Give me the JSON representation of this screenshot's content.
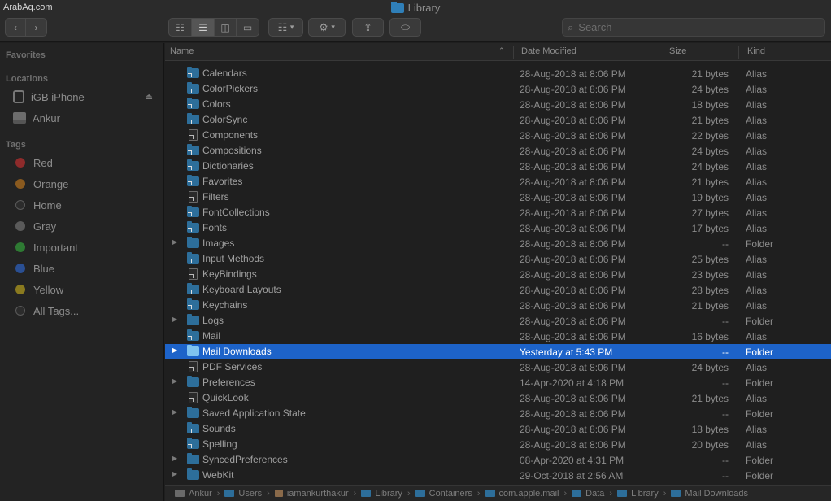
{
  "watermark": "ArabAq.com",
  "window": {
    "title": "Library"
  },
  "toolbar": {
    "back_icon": "chevron-left-icon",
    "forward_icon": "chevron-right-icon",
    "search_placeholder": "Search"
  },
  "sidebar": {
    "favorites_heading": "Favorites",
    "locations_heading": "Locations",
    "locations": [
      {
        "label": "iGB iPhone",
        "icon": "iphone-icon"
      },
      {
        "label": "Ankur",
        "icon": "hard-drive-icon"
      }
    ],
    "tags_heading": "Tags",
    "tags": [
      {
        "label": "Red",
        "color": "#8e2b2b"
      },
      {
        "label": "Orange",
        "color": "#8a5a1f"
      },
      {
        "label": "Home",
        "color": "#3a3a3a"
      },
      {
        "label": "Gray",
        "color": "#5a5a5a"
      },
      {
        "label": "Important",
        "color": "#2e7a33"
      },
      {
        "label": "Blue",
        "color": "#2a4f93"
      },
      {
        "label": "Yellow",
        "color": "#8a7a1f"
      },
      {
        "label": "All Tags...",
        "color": "#3a3a3a"
      }
    ]
  },
  "columns": {
    "name": "Name",
    "date": "Date Modified",
    "size": "Size",
    "kind": "Kind"
  },
  "files": [
    {
      "name": "Calendars",
      "date": "28-Aug-2018 at 8:06 PM",
      "size": "21 bytes",
      "kind": "Alias",
      "icon": "folder-alias",
      "expandable": false
    },
    {
      "name": "ColorPickers",
      "date": "28-Aug-2018 at 8:06 PM",
      "size": "24 bytes",
      "kind": "Alias",
      "icon": "folder-alias",
      "expandable": false
    },
    {
      "name": "Colors",
      "date": "28-Aug-2018 at 8:06 PM",
      "size": "18 bytes",
      "kind": "Alias",
      "icon": "folder-alias",
      "expandable": false
    },
    {
      "name": "ColorSync",
      "date": "28-Aug-2018 at 8:06 PM",
      "size": "21 bytes",
      "kind": "Alias",
      "icon": "folder-alias",
      "expandable": false
    },
    {
      "name": "Components",
      "date": "28-Aug-2018 at 8:06 PM",
      "size": "22 bytes",
      "kind": "Alias",
      "icon": "doc-alias",
      "expandable": false
    },
    {
      "name": "Compositions",
      "date": "28-Aug-2018 at 8:06 PM",
      "size": "24 bytes",
      "kind": "Alias",
      "icon": "folder-alias",
      "expandable": false
    },
    {
      "name": "Dictionaries",
      "date": "28-Aug-2018 at 8:06 PM",
      "size": "24 bytes",
      "kind": "Alias",
      "icon": "folder-alias",
      "expandable": false
    },
    {
      "name": "Favorites",
      "date": "28-Aug-2018 at 8:06 PM",
      "size": "21 bytes",
      "kind": "Alias",
      "icon": "folder-alias",
      "expandable": false
    },
    {
      "name": "Filters",
      "date": "28-Aug-2018 at 8:06 PM",
      "size": "19 bytes",
      "kind": "Alias",
      "icon": "doc-alias",
      "expandable": false
    },
    {
      "name": "FontCollections",
      "date": "28-Aug-2018 at 8:06 PM",
      "size": "27 bytes",
      "kind": "Alias",
      "icon": "folder-alias",
      "expandable": false
    },
    {
      "name": "Fonts",
      "date": "28-Aug-2018 at 8:06 PM",
      "size": "17 bytes",
      "kind": "Alias",
      "icon": "folder-alias",
      "expandable": false
    },
    {
      "name": "Images",
      "date": "28-Aug-2018 at 8:06 PM",
      "size": "--",
      "kind": "Folder",
      "icon": "folder",
      "expandable": true
    },
    {
      "name": "Input Methods",
      "date": "28-Aug-2018 at 8:06 PM",
      "size": "25 bytes",
      "kind": "Alias",
      "icon": "folder-alias",
      "expandable": false
    },
    {
      "name": "KeyBindings",
      "date": "28-Aug-2018 at 8:06 PM",
      "size": "23 bytes",
      "kind": "Alias",
      "icon": "doc-alias",
      "expandable": false
    },
    {
      "name": "Keyboard Layouts",
      "date": "28-Aug-2018 at 8:06 PM",
      "size": "28 bytes",
      "kind": "Alias",
      "icon": "folder-alias",
      "expandable": false
    },
    {
      "name": "Keychains",
      "date": "28-Aug-2018 at 8:06 PM",
      "size": "21 bytes",
      "kind": "Alias",
      "icon": "folder-alias",
      "expandable": false
    },
    {
      "name": "Logs",
      "date": "28-Aug-2018 at 8:06 PM",
      "size": "--",
      "kind": "Folder",
      "icon": "folder",
      "expandable": true
    },
    {
      "name": "Mail",
      "date": "28-Aug-2018 at 8:06 PM",
      "size": "16 bytes",
      "kind": "Alias",
      "icon": "folder-alias",
      "expandable": false
    },
    {
      "name": "Mail Downloads",
      "date": "Yesterday at 5:43 PM",
      "size": "--",
      "kind": "Folder",
      "icon": "folder",
      "expandable": true,
      "selected": true
    },
    {
      "name": "PDF Services",
      "date": "28-Aug-2018 at 8:06 PM",
      "size": "24 bytes",
      "kind": "Alias",
      "icon": "doc-alias",
      "expandable": false
    },
    {
      "name": "Preferences",
      "date": "14-Apr-2020 at 4:18 PM",
      "size": "--",
      "kind": "Folder",
      "icon": "folder",
      "expandable": true
    },
    {
      "name": "QuickLook",
      "date": "28-Aug-2018 at 8:06 PM",
      "size": "21 bytes",
      "kind": "Alias",
      "icon": "doc-alias",
      "expandable": false
    },
    {
      "name": "Saved Application State",
      "date": "28-Aug-2018 at 8:06 PM",
      "size": "--",
      "kind": "Folder",
      "icon": "folder",
      "expandable": true
    },
    {
      "name": "Sounds",
      "date": "28-Aug-2018 at 8:06 PM",
      "size": "18 bytes",
      "kind": "Alias",
      "icon": "folder-alias",
      "expandable": false
    },
    {
      "name": "Spelling",
      "date": "28-Aug-2018 at 8:06 PM",
      "size": "20 bytes",
      "kind": "Alias",
      "icon": "folder-alias",
      "expandable": false
    },
    {
      "name": "SyncedPreferences",
      "date": "08-Apr-2020 at 4:31 PM",
      "size": "--",
      "kind": "Folder",
      "icon": "folder",
      "expandable": true
    },
    {
      "name": "WebKit",
      "date": "29-Oct-2018 at 2:56 AM",
      "size": "--",
      "kind": "Folder",
      "icon": "folder",
      "expandable": true
    }
  ],
  "pathbar": [
    {
      "label": "Ankur",
      "icon": "hard-drive-icon"
    },
    {
      "label": "Users",
      "icon": "folder-icon"
    },
    {
      "label": "iamankurthakur",
      "icon": "home-icon"
    },
    {
      "label": "Library",
      "icon": "folder-icon"
    },
    {
      "label": "Containers",
      "icon": "folder-icon"
    },
    {
      "label": "com.apple.mail",
      "icon": "folder-icon"
    },
    {
      "label": "Data",
      "icon": "folder-icon"
    },
    {
      "label": "Library",
      "icon": "folder-icon"
    },
    {
      "label": "Mail Downloads",
      "icon": "folder-icon"
    }
  ]
}
